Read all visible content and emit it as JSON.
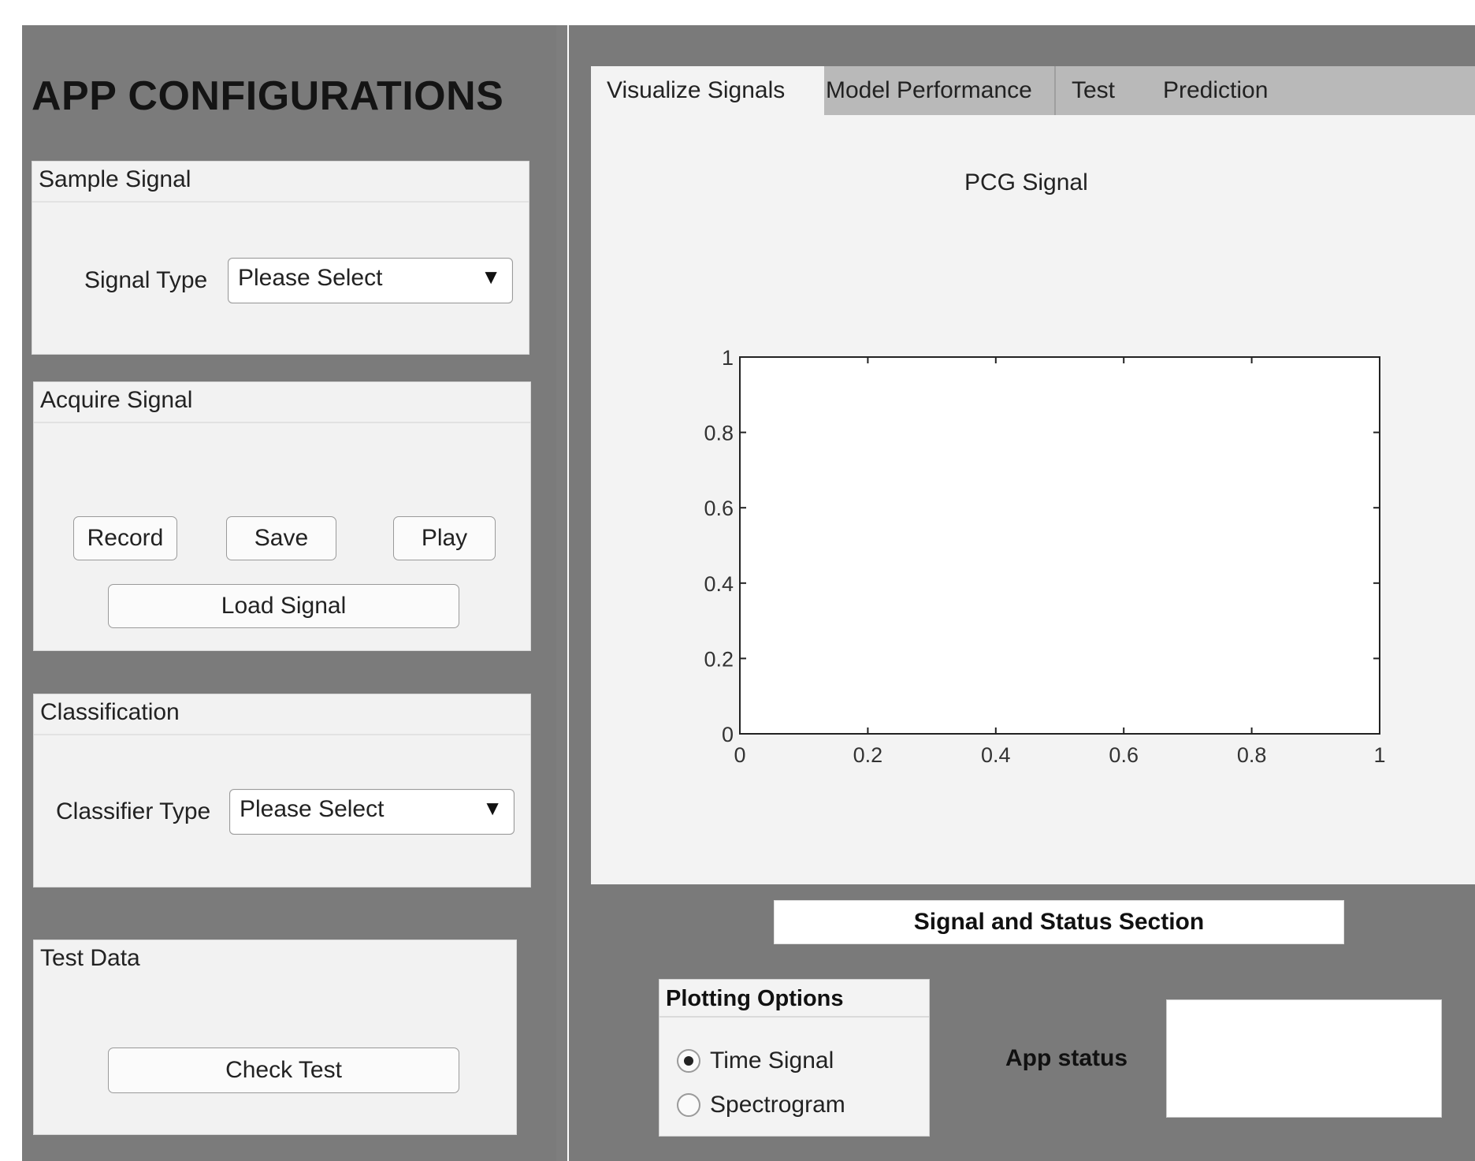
{
  "config": {
    "title": "APP CONFIGURATIONS",
    "sample_signal": {
      "title": "Sample Signal",
      "signal_type_label": "Signal Type",
      "signal_type_value": "Please Select",
      "dropdown_arrow": "▼"
    },
    "acquire_signal": {
      "title": "Acquire Signal",
      "record_label": "Record",
      "save_label": "Save",
      "play_label": "Play",
      "load_label": "Load Signal"
    },
    "classification": {
      "title": "Classification",
      "classifier_type_label": "Classifier Type",
      "classifier_type_value": "Please Select",
      "dropdown_arrow": "▼"
    },
    "test_data": {
      "title": "Test Data",
      "check_label": "Check Test"
    }
  },
  "tabs": [
    "Visualize Signals",
    "Model Performance",
    "Test",
    "Prediction"
  ],
  "active_tab": "Visualize Signals",
  "chart_data": {
    "type": "line",
    "title": "PCG Signal",
    "series": [],
    "xlim": [
      0,
      1
    ],
    "ylim": [
      0,
      1
    ],
    "xticks": [
      "0",
      "0.2",
      "0.4",
      "0.6",
      "0.8",
      "1"
    ],
    "yticks": [
      "0",
      "0.2",
      "0.4",
      "0.6",
      "0.8",
      "1"
    ],
    "grid": false
  },
  "status_section": {
    "header": "Signal and Status Section",
    "plotting_options_title": "Plotting Options",
    "options": [
      "Time Signal",
      "Spectrogram"
    ],
    "selected_option": "Time Signal",
    "app_status_label": "App status",
    "app_status_value": ""
  }
}
